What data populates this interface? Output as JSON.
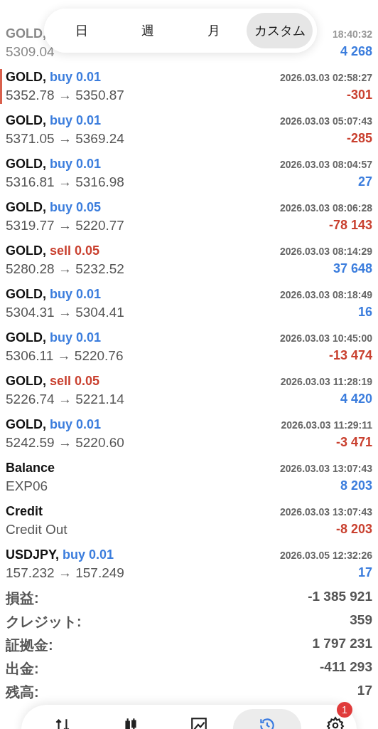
{
  "period_tabs": [
    {
      "label": "日",
      "selected": false
    },
    {
      "label": "週",
      "selected": false
    },
    {
      "label": "月",
      "selected": false
    },
    {
      "label": "カスタム",
      "selected": true
    }
  ],
  "deals": [
    {
      "symbol": "GOLD,",
      "time": "18:40:32",
      "prices": "5309.04",
      "profit": "4 268",
      "loss": false,
      "marked": false
    },
    {
      "symbol": "GOLD,",
      "side": "buy 0.01",
      "sell": false,
      "time": "2026.03.03 02:58:27",
      "prices": "5352.78 → 5350.87",
      "profit": "-301",
      "loss": true,
      "marked": true
    },
    {
      "symbol": "GOLD,",
      "side": "buy 0.01",
      "sell": false,
      "time": "2026.03.03 05:07:43",
      "prices": "5371.05 → 5369.24",
      "profit": "-285",
      "loss": true,
      "marked": false
    },
    {
      "symbol": "GOLD,",
      "side": "buy 0.01",
      "sell": false,
      "time": "2026.03.03 08:04:57",
      "prices": "5316.81 → 5316.98",
      "profit": "27",
      "loss": false,
      "marked": false
    },
    {
      "symbol": "GOLD,",
      "side": "buy 0.05",
      "sell": false,
      "time": "2026.03.03 08:06:28",
      "prices": "5319.77 → 5220.77",
      "profit": "-78 143",
      "loss": true,
      "marked": false
    },
    {
      "symbol": "GOLD,",
      "side": "sell 0.05",
      "sell": true,
      "time": "2026.03.03 08:14:29",
      "prices": "5280.28 → 5232.52",
      "profit": "37 648",
      "loss": false,
      "marked": false
    },
    {
      "symbol": "GOLD,",
      "side": "buy 0.01",
      "sell": false,
      "time": "2026.03.03 08:18:49",
      "prices": "5304.31 → 5304.41",
      "profit": "16",
      "loss": false,
      "marked": false
    },
    {
      "symbol": "GOLD,",
      "side": "buy 0.01",
      "sell": false,
      "time": "2026.03.03 10:45:00",
      "prices": "5306.11 → 5220.76",
      "profit": "-13 474",
      "loss": true,
      "marked": false
    },
    {
      "symbol": "GOLD,",
      "side": "sell 0.05",
      "sell": true,
      "time": "2026.03.03 11:28:19",
      "prices": "5226.74 → 5221.14",
      "profit": "4 420",
      "loss": false,
      "marked": false
    },
    {
      "symbol": "GOLD,",
      "side": "buy 0.01",
      "sell": false,
      "time": "2026.03.03 11:29:11",
      "prices": "5242.59 → 5220.60",
      "profit": "-3 471",
      "loss": true,
      "marked": false
    },
    {
      "symbol": "Balance",
      "time": "2026.03.03 13:07:43",
      "prices": "EXP06",
      "profit": "8 203",
      "loss": false,
      "marked": false
    },
    {
      "symbol": "Credit",
      "time": "2026.03.03 13:07:43",
      "prices": "Credit Out",
      "profit": "-8 203",
      "loss": true,
      "marked": false
    },
    {
      "symbol": "USDJPY,",
      "side": "buy 0.01",
      "sell": false,
      "time": "2026.03.05 12:32:26",
      "prices": "157.232 → 157.249",
      "profit": "17",
      "loss": false,
      "marked": false
    }
  ],
  "summary": [
    {
      "label": "損益:",
      "value": "-1 385 921"
    },
    {
      "label": "クレジット:",
      "value": "359"
    },
    {
      "label": "証拠金:",
      "value": "1 797 231"
    },
    {
      "label": "出金:",
      "value": "-411 293"
    },
    {
      "label": "残高:",
      "value": "17"
    }
  ],
  "nav": [
    {
      "selected": false
    },
    {
      "selected": false
    },
    {
      "selected": false
    },
    {
      "selected": true
    },
    {
      "selected": false,
      "badge": "1"
    }
  ]
}
